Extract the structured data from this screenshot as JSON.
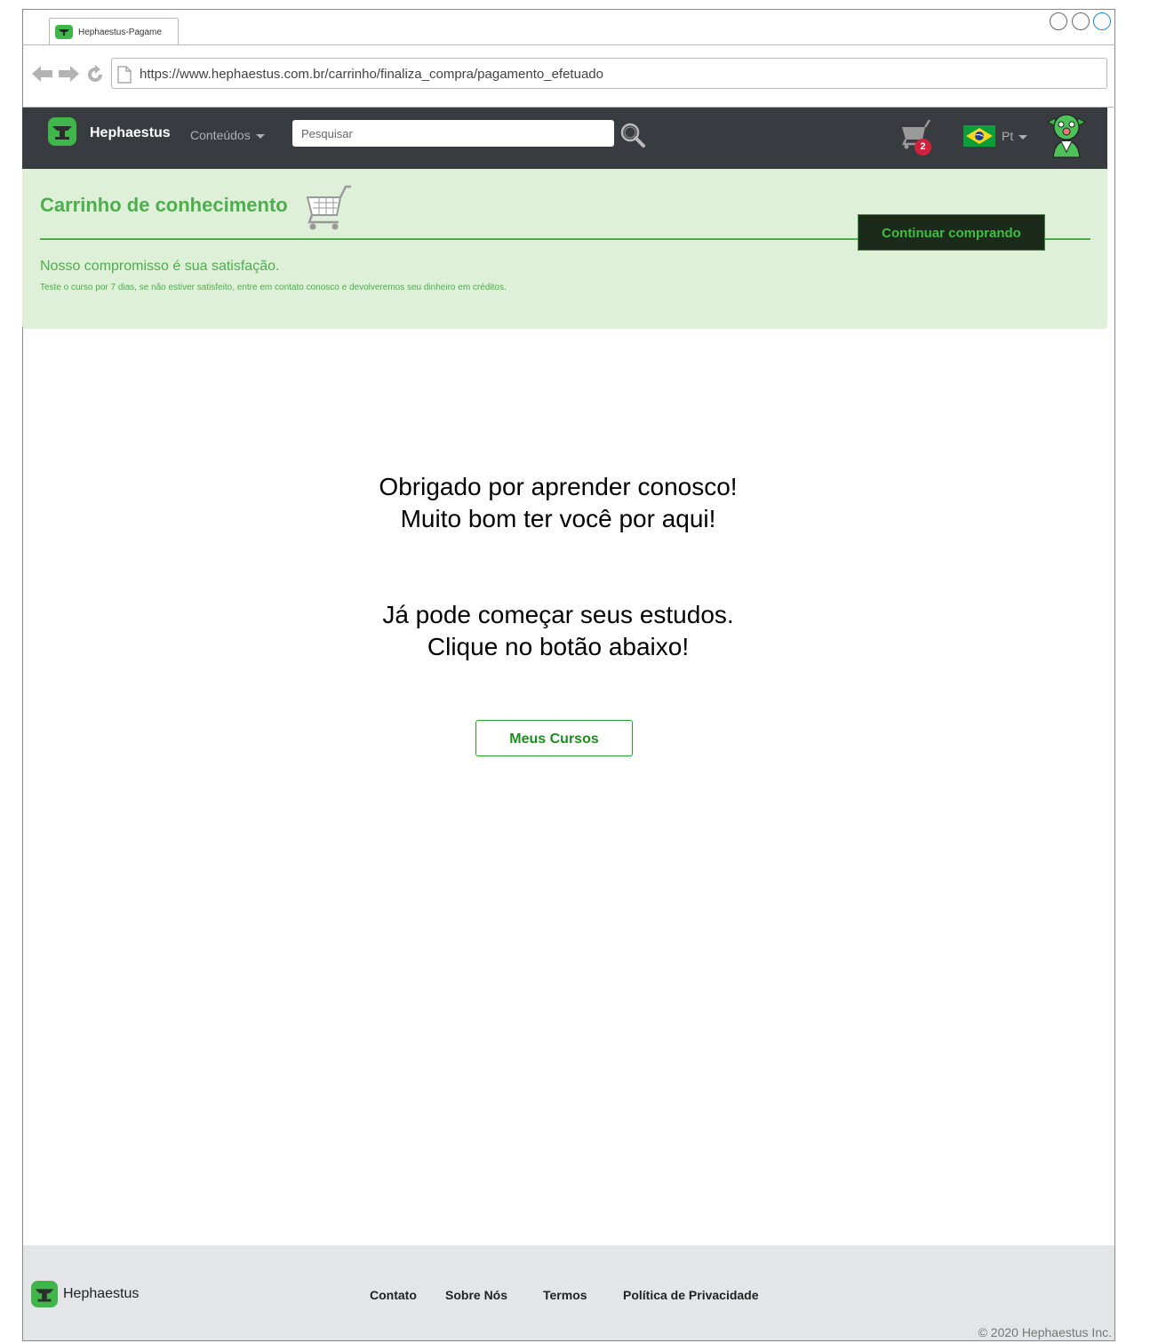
{
  "browser": {
    "tab_title": "Hephaestus-Pagame",
    "url": "https://www.hephaestus.com.br/carrinho/finaliza_compra/pagamento_efetuado"
  },
  "navbar": {
    "brand": "Hephaestus",
    "menu_label": "Conteúdos",
    "search_placeholder": "Pesquisar",
    "cart_count": "2",
    "language": "Pt"
  },
  "banner": {
    "title": "Carrinho de conhecimento",
    "continue_label": "Continuar comprando",
    "commitment": "Nosso compromisso é sua satisfação.",
    "commitment_detail": "Teste o curso por 7 dias, se não estiver satisfeito, entre em contato conosco e devolveremos seu dinheiro em créditos."
  },
  "main": {
    "thanks_line1": "Obrigado por aprender conosco!",
    "thanks_line2": "Muito bom ter você por aqui!",
    "start_line1": "Já pode começar seus estudos.",
    "start_line2": "Clique no botão abaixo!",
    "button_label": "Meus Cursos"
  },
  "footer": {
    "brand": "Hephaestus",
    "links": [
      "Contato",
      "Sobre Nós",
      "Termos",
      "Política de Privacidade"
    ],
    "copyright": "© 2020 Hephaestus Inc."
  },
  "colors": {
    "navbar_bg": "#383b40",
    "banner_bg": "#dff0d8",
    "accent_green": "#4cae4c",
    "badge_red": "#d0223b",
    "footer_bg": "#e4e5e8"
  }
}
